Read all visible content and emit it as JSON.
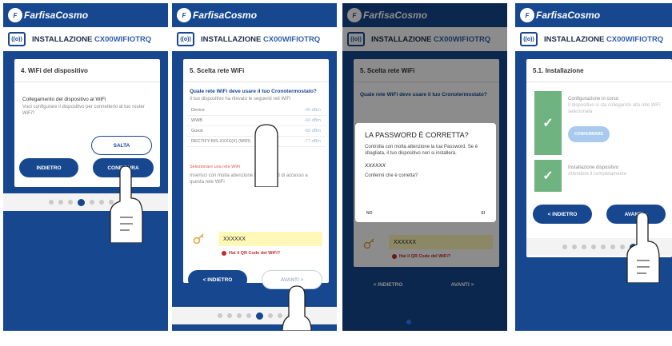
{
  "app": {
    "logo_text": "FarfisaCosmo",
    "logo_mark": "F",
    "install_label": "INSTALLAZIONE",
    "model": "CX00WIFIOTRQ",
    "install_icon_text": "((o))"
  },
  "screen1": {
    "header": "4. WiFi del dispositivo",
    "heading": "Collegamento del dispositivo al WiFi",
    "body": "Vuoi configurare il dispositivo per connetterlo al tuo router WiFi?",
    "skip_button": "SALTA",
    "back_button": "INDIETRO",
    "configure_button": "CONFIGURA",
    "page_dots": 8,
    "active_dot": 3
  },
  "screen2": {
    "header": "5. Scelta rete WiFi",
    "question": "Quale rete WiFi deve usare il tuo Cronotermostato?",
    "hint": "Il tuo dispositivo ha rilevato le seguenti reti WiFi",
    "networks": [
      {
        "name": "Device",
        "signal": "-45 dBm"
      },
      {
        "name": "WWB",
        "signal": "-60 dBm"
      },
      {
        "name": "Guest",
        "signal": "-65 dBm"
      },
      {
        "name": "RECTIFY-BIS-XXXX(X) (WIFI)",
        "signal": "-77 dBm"
      }
    ],
    "selected_label": "Selezionare una rete WiFi",
    "password_prompt": "Inserisci con molta attenzione la password di accesso a questa rete WiFi",
    "password_value": "XXXXXX",
    "qr_link": "Hai il QR Code del WiFi?",
    "back_button": "< INDIETRO",
    "next_button": "AVANTI >",
    "page_dots": 8,
    "active_dot": 4
  },
  "screen3": {
    "header": "5. Scelta rete WiFi",
    "question": "Quale rete WiFi deve usare il tuo Cronotermostato?",
    "dialog_title": "LA PASSWORD È CORRETTA?",
    "dialog_body": "Controlla con molta attenzione la tua Password. Se è sbagliata, il tuo dispositivo non si installerà.",
    "dialog_password": "XXXXXX",
    "dialog_question": "Confermi che è corretta?",
    "dialog_no": "NO",
    "dialog_yes": "SI",
    "password_value": "XXXXXX",
    "qr_link": "Hai il QR Code del WiFi?",
    "back_button": "< INDIETRO",
    "next_button": "AVANTI >"
  },
  "screen4": {
    "header": "5.1. Installazione",
    "step1_title": "Configurazione in corso",
    "step1_body": "Il dispositivo si sta collegando alla rete WiFi selezionata",
    "step1_button": "CONFERMARE",
    "step2_title": "Installazione dispositivo",
    "step2_body": "Attendere il completamento",
    "back_button": "< INDIETRO",
    "next_button": "AVANTI >",
    "page_dots": 8,
    "active_dot": 7
  },
  "colors": {
    "brand": "#16478f",
    "check": "#6fb381",
    "password_bg": "#fff8b8",
    "error": "#c62828"
  }
}
